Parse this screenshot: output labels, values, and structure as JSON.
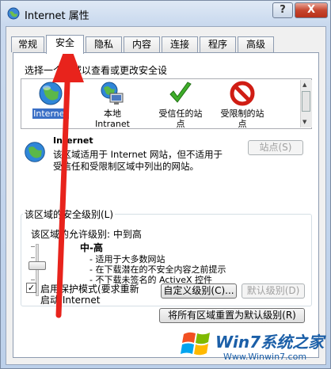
{
  "window": {
    "title": "Internet 属性",
    "help_label": "?",
    "close_label": "X"
  },
  "tabs": [
    {
      "label": "常规"
    },
    {
      "label": "安全"
    },
    {
      "label": "隐私"
    },
    {
      "label": "内容"
    },
    {
      "label": "连接"
    },
    {
      "label": "程序"
    },
    {
      "label": "高级"
    }
  ],
  "security": {
    "zone_prompt": "选择一个区域以查看或更改安全设",
    "zones": [
      {
        "label": "Internet",
        "icon": "globe-icon"
      },
      {
        "label": "本地\nIntranet",
        "icon": "local-intranet-icon"
      },
      {
        "label": "受信任的站\n点",
        "icon": "checkmark-icon"
      },
      {
        "label": "受限制的站\n点",
        "icon": "restricted-icon"
      }
    ],
    "zone_title": "Internet",
    "zone_desc_line1": "该区域适用于 Internet 网站，但不适用于",
    "zone_desc_line2": "受信任和受限制区域中列出的网站。",
    "sites_button": "站点(S)",
    "level_group_title": "该区域的安全级别(L)",
    "allowed_levels": "该区域的允许级别: 中到高",
    "level_name": "中-高",
    "level_items": [
      "- 适用于大多数网站",
      "- 在下载潜在的不安全内容之前提示",
      "- 不下载未签名的 ActiveX 控件"
    ],
    "protected_mode_label_line1": "启用保护模式(要求重新",
    "protected_mode_label_line2": "启动 Internet",
    "protected_mode_checked": "✓",
    "custom_level_button": "自定义级别(C)...",
    "default_level_button": "默认级别(D)",
    "reset_all_button": "将所有区域重置为默认级别(R)"
  },
  "watermark": {
    "brand": "Win7系统之家",
    "url": "Www.Winwin7.com"
  },
  "colors": {
    "selection": "#3a6fc6",
    "annotation_arrow": "#e8231c"
  }
}
